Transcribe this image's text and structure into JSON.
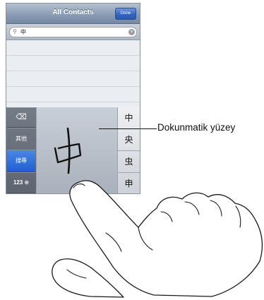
{
  "navbar": {
    "title": "All Contacts",
    "done_label": "Done"
  },
  "search": {
    "glyph": "⚲",
    "value": "中",
    "clear_glyph": "×"
  },
  "keyboard": {
    "delete_label": "⌫",
    "other_label": "其他",
    "search_label": "搜尋",
    "numbers_label": "123",
    "globe_glyph": "⊕",
    "handwritten_char": "中",
    "candidates": [
      "中",
      "央",
      "虫",
      "申"
    ]
  },
  "annotation": {
    "label": "Dokunmatik yüzey"
  }
}
